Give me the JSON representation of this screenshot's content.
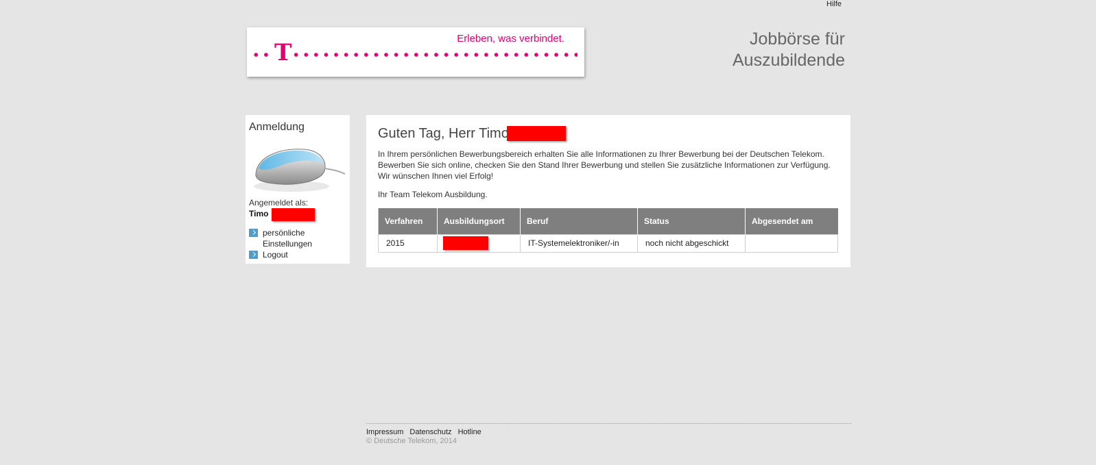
{
  "header": {
    "help_label": "Hilfe",
    "slogan": "Erleben, was verbindet.",
    "logo_letter": "T",
    "title_line1": "Jobbörse für",
    "title_line2": "Auszubildende"
  },
  "sidebar": {
    "title": "Anmeldung",
    "logged_in_label": "Angemeldet als:",
    "user_first_name": "Timo",
    "menu": [
      {
        "label": "persönliche Einstellungen"
      },
      {
        "label": "Logout"
      }
    ]
  },
  "main": {
    "greeting": "Guten Tag, Herr Timo",
    "intro_line1": "In Ihrem persönlichen Bewerbungsbereich erhalten Sie alle Informationen zu Ihrer Bewerbung bei der Deutschen Telekom.",
    "intro_line2": "Bewerben Sie sich online, checken Sie den Stand Ihrer Bewerbung und stellen Sie zusätzliche Informationen zur Verfügung.",
    "intro_line3": "Wir wünschen Ihnen viel Erfolg!",
    "signoff": "Ihr Team Telekom Ausbildung.",
    "table": {
      "headers": [
        "Verfahren",
        "Ausbildungsort",
        "Beruf",
        "Status",
        "Abgesendet am"
      ],
      "rows": [
        {
          "verfahren": "2015",
          "ort": "",
          "beruf": "IT-Systemelektroniker/-in",
          "status": "noch nicht abgeschickt",
          "abgesendet": ""
        }
      ]
    }
  },
  "footer": {
    "links": [
      "Impressum",
      "Datenschutz",
      "Hotline"
    ],
    "copyright": "© Deutsche Telekom, 2014"
  },
  "colors": {
    "brand": "#e20074",
    "page_bg": "#e5e5e5",
    "table_header": "#7f7f7f",
    "menu_arrow": "#4e9ec9",
    "redaction": "#ff0000"
  }
}
